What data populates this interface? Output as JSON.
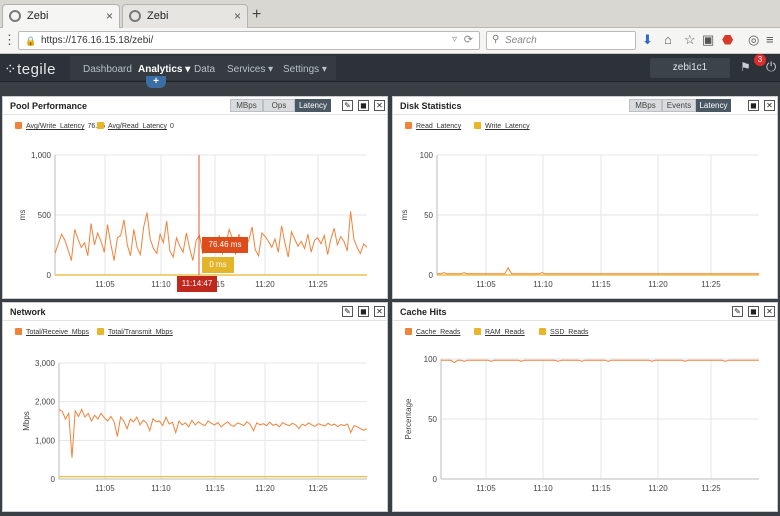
{
  "browser": {
    "tabs": [
      {
        "title": "Zebi",
        "close": "×"
      },
      {
        "title": "Zebi",
        "close": "×"
      }
    ],
    "new_tab": "+",
    "url": "https://176.16.15.18/zebi/",
    "search_placeholder": "Search"
  },
  "app": {
    "logo": "tegile",
    "menu": [
      {
        "label": "Dashboard"
      },
      {
        "label": "Analytics ▾"
      },
      {
        "label": "Data"
      },
      {
        "label": "Services ▾"
      },
      {
        "label": "Settings ▾"
      }
    ],
    "add_label": "+",
    "user": "zebi1c1",
    "notifications": "3"
  },
  "colors": {
    "accent_orange": "#f0823a",
    "accent_yellow": "#e9b52a",
    "tooltip_red": "#c0281d"
  },
  "panels": {
    "pool": {
      "title": "Pool Performance",
      "segments": [
        "MBps",
        "Ops",
        "Latency"
      ],
      "legend": [
        {
          "label": "Avg/Write_Latency",
          "value": "76.46"
        },
        {
          "label": "Avg/Read_Latency",
          "value": "0"
        }
      ],
      "tooltip_write": "76.46 ms",
      "tooltip_read": "0 ms",
      "tooltip_time": "11:14:47"
    },
    "disk": {
      "title": "Disk Statistics",
      "segments": [
        "MBps",
        "Events",
        "Latency"
      ],
      "legend": [
        {
          "label": "Read_Latency"
        },
        {
          "label": "Write_Latency"
        }
      ]
    },
    "network": {
      "title": "Network",
      "legend": [
        {
          "label": "Total/Receive_Mbps"
        },
        {
          "label": "Total/Transmit_Mbps"
        }
      ]
    },
    "cache": {
      "title": "Cache Hits",
      "legend": [
        {
          "label": "Cache_Reads"
        },
        {
          "label": "RAM_Reads"
        },
        {
          "label": "SSD_Reads"
        }
      ]
    }
  },
  "chart_data": [
    {
      "type": "line",
      "panel": "Pool Performance",
      "ylabel": "ms",
      "ylim": [
        0,
        1000
      ],
      "yticks": [
        "0",
        "500",
        "1,000"
      ],
      "xticks": [
        "11:05",
        "11:10",
        "11:15",
        "11:20",
        "11:25"
      ],
      "series": [
        {
          "name": "Avg/Write_Latency",
          "values": [
            180,
            260,
            340,
            290,
            210,
            120,
            380,
            300,
            230,
            270,
            160,
            430,
            250,
            350,
            280,
            190,
            420,
            260,
            120,
            310,
            330,
            460,
            250,
            160,
            380,
            230,
            170,
            400,
            520,
            300,
            220,
            180,
            340,
            270,
            450,
            200,
            150,
            310,
            240,
            190,
            350,
            220,
            120,
            290,
            330,
            180,
            230,
            300,
            260,
            200,
            330,
            180,
            250,
            380,
            310,
            170,
            340,
            260,
            230,
            290,
            400,
            210,
            160,
            350,
            320,
            280,
            230,
            300,
            190,
            410,
            270,
            150,
            360,
            300,
            240,
            280,
            220,
            340,
            190,
            290,
            310,
            260,
            330,
            170,
            300,
            390,
            250,
            320,
            280,
            200,
            530,
            300,
            230,
            180,
            260,
            230
          ]
        },
        {
          "name": "Avg/Read_Latency",
          "values": [
            0,
            0,
            0,
            0,
            0,
            0,
            0,
            0,
            0,
            0,
            0,
            0,
            0,
            0,
            0,
            0,
            0,
            0,
            0,
            0,
            0,
            0,
            0,
            0,
            0,
            0,
            0,
            0,
            0,
            0,
            0,
            0,
            0,
            0,
            0,
            0,
            0,
            0,
            0,
            0,
            0,
            0,
            0,
            0,
            0,
            0,
            0,
            0,
            0,
            0,
            0,
            0,
            0,
            0,
            0,
            0,
            0,
            0,
            0,
            0,
            0,
            0,
            0,
            0,
            0,
            0,
            0,
            0,
            0,
            0,
            0,
            0,
            0,
            0,
            0,
            0,
            0,
            0,
            0,
            0,
            0,
            0,
            0,
            0,
            0,
            0,
            0,
            0,
            0,
            0,
            0,
            0,
            0,
            0,
            0,
            0
          ]
        }
      ],
      "cursor_x": "11:14:47"
    },
    {
      "type": "line",
      "panel": "Disk Statistics",
      "ylabel": "ms",
      "ylim": [
        0,
        100
      ],
      "yticks": [
        "0",
        "50",
        "100"
      ],
      "xticks": [
        "11:05",
        "11:10",
        "11:15",
        "11:20",
        "11:25"
      ],
      "series": [
        {
          "name": "Read_Latency",
          "values": [
            1,
            1,
            2,
            1,
            1,
            1,
            1,
            1,
            2,
            1,
            1,
            1,
            1,
            1,
            1,
            1,
            1,
            1,
            1,
            1,
            1,
            6,
            1,
            1,
            1,
            1,
            1,
            1,
            1,
            1,
            1,
            2,
            1,
            1,
            1,
            1,
            1,
            1,
            1,
            1,
            1,
            1,
            1,
            1,
            1,
            1,
            1,
            1,
            1,
            1,
            1,
            1,
            1,
            1,
            1,
            1,
            1,
            1,
            1,
            1,
            1,
            1,
            1,
            1,
            1,
            1,
            1,
            1,
            1,
            1,
            1,
            1,
            1,
            1,
            1,
            1,
            1,
            1,
            1,
            1,
            1,
            1,
            1,
            1,
            1,
            1,
            1,
            1,
            1,
            1,
            1,
            1,
            1,
            1,
            1,
            1
          ]
        },
        {
          "name": "Write_Latency",
          "values": [
            0,
            0,
            0,
            0,
            0,
            0,
            0,
            0,
            0,
            0,
            0,
            0,
            0,
            0,
            0,
            0,
            0,
            0,
            0,
            0,
            0,
            0,
            0,
            0,
            0,
            0,
            0,
            0,
            0,
            0,
            0,
            0,
            0,
            0,
            0,
            0,
            0,
            0,
            0,
            0,
            0,
            0,
            0,
            0,
            0,
            0,
            0,
            0,
            0,
            0,
            0,
            0,
            0,
            0,
            0,
            0,
            0,
            0,
            0,
            0,
            0,
            0,
            0,
            0,
            0,
            0,
            0,
            0,
            0,
            0,
            0,
            0,
            0,
            0,
            0,
            0,
            0,
            0,
            0,
            0,
            0,
            0,
            0,
            0,
            0,
            0,
            0,
            0,
            0,
            0,
            0,
            0,
            0,
            0,
            0,
            0
          ]
        }
      ]
    },
    {
      "type": "line",
      "panel": "Network",
      "ylabel": "Mbps",
      "ylim": [
        0,
        3000
      ],
      "yticks": [
        "0",
        "1,000",
        "2,000",
        "3,000"
      ],
      "xticks": [
        "11:05",
        "11:10",
        "11:15",
        "11:20",
        "11:25"
      ],
      "series": [
        {
          "name": "Total/Receive_Mbps",
          "values": [
            1800,
            1750,
            1550,
            1700,
            550,
            1760,
            1620,
            1800,
            1600,
            1700,
            1500,
            1650,
            1550,
            1700,
            1580,
            1500,
            1620,
            1480,
            1100,
            1600,
            1500,
            1300,
            1550,
            1480,
            1600,
            1400,
            1520,
            1450,
            1250,
            1560,
            1480,
            1500,
            1380,
            1600,
            1420,
            1470,
            1200,
            1500,
            1400,
            1450,
            1350,
            1520,
            1400,
            1480,
            1420,
            1380,
            1500,
            1440,
            1400,
            1460,
            1350,
            1420,
            1480,
            1400,
            1360,
            1450,
            1420,
            1380,
            1480,
            1410,
            1250,
            1450,
            1400,
            1430,
            1380,
            1470,
            1390,
            1420,
            1350,
            1460,
            1410,
            1380,
            1440,
            1400,
            1300,
            1420,
            1380,
            1450,
            1400,
            1360,
            1430,
            1400,
            1370,
            1440,
            1390,
            1420,
            1350,
            1410,
            1380,
            1420,
            1200,
            1380,
            1350,
            1300,
            1260,
            1300
          ]
        },
        {
          "name": "Total/Transmit_Mbps",
          "values": [
            60,
            60,
            60,
            60,
            60,
            60,
            60,
            60,
            60,
            60,
            60,
            60,
            60,
            60,
            60,
            60,
            60,
            60,
            60,
            60,
            60,
            60,
            60,
            60,
            60,
            60,
            60,
            60,
            60,
            60,
            60,
            60,
            60,
            60,
            60,
            60,
            60,
            60,
            60,
            60,
            60,
            60,
            60,
            60,
            60,
            60,
            60,
            60,
            60,
            60,
            60,
            60,
            60,
            60,
            60,
            60,
            60,
            60,
            60,
            60,
            60,
            60,
            60,
            60,
            60,
            60,
            60,
            60,
            60,
            60,
            60,
            60,
            60,
            60,
            60,
            60,
            60,
            60,
            60,
            60,
            60,
            60,
            60,
            60,
            60,
            60,
            60,
            60,
            60,
            60,
            60,
            60,
            60,
            60,
            60,
            60
          ]
        }
      ]
    },
    {
      "type": "line",
      "panel": "Cache Hits",
      "ylabel": "Percentage",
      "ylim": [
        0,
        100
      ],
      "yticks": [
        "0",
        "50",
        "100"
      ],
      "xticks": [
        "11:05",
        "11:10",
        "11:15",
        "11:20",
        "11:25"
      ],
      "series": [
        {
          "name": "Cache_Reads",
          "values": [
            99,
            99,
            99,
            99,
            97,
            99,
            99,
            98,
            99,
            99,
            99,
            99,
            99,
            99,
            99,
            98,
            99,
            99,
            99,
            99,
            99,
            99,
            99,
            99,
            98,
            99,
            99,
            99,
            99,
            99,
            99,
            99,
            99,
            99,
            99,
            98,
            99,
            99,
            99,
            99,
            99,
            99,
            98,
            99,
            99,
            99,
            99,
            99,
            99,
            99,
            98,
            99,
            99,
            99,
            99,
            99,
            99,
            99,
            99,
            99,
            99,
            99,
            99,
            98,
            99,
            99,
            99,
            99,
            99,
            99,
            99,
            99,
            99,
            98,
            99,
            99,
            99,
            99,
            99,
            99,
            99,
            99,
            99,
            99,
            99,
            98,
            99,
            99,
            99,
            99,
            99,
            99,
            99,
            99,
            99,
            99
          ]
        },
        {
          "name": "RAM_Reads",
          "values": []
        },
        {
          "name": "SSD_Reads",
          "values": []
        }
      ]
    }
  ]
}
